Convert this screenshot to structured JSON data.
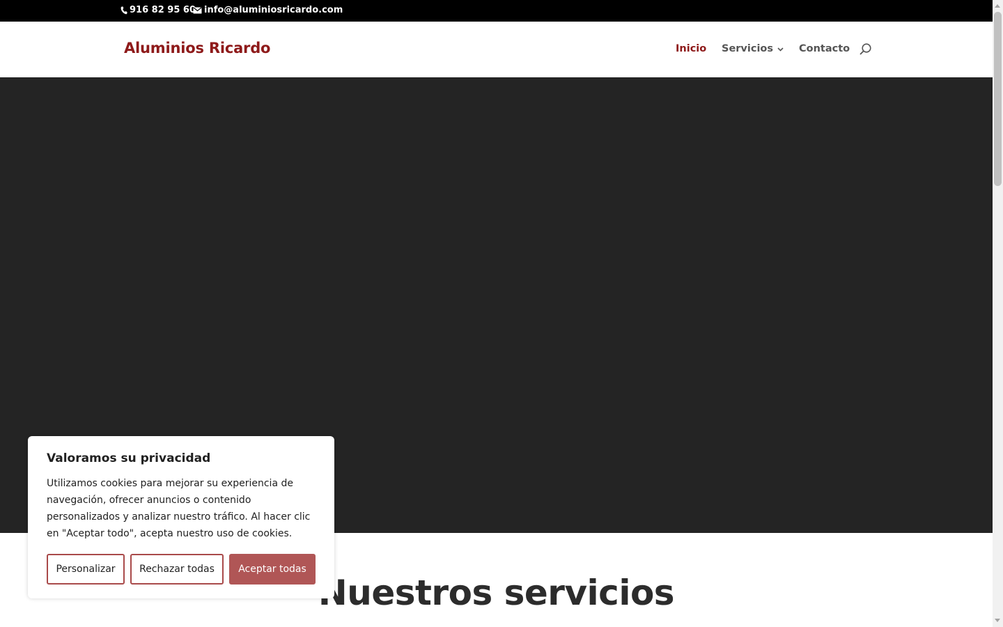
{
  "topbar": {
    "phone": "916 82 95 60",
    "email": "info@aluminiosricardo.com",
    "phone_icon": "phone-icon",
    "email_icon": "envelope-icon"
  },
  "header": {
    "logo": "Aluminios Ricardo",
    "nav": {
      "inicio": "Inicio",
      "servicios": "Servicios",
      "contacto": "Contacto"
    },
    "search_icon": "search-icon"
  },
  "main": {
    "section_title": "Nuestros servicios"
  },
  "cookie": {
    "title": "Valoramos su privacidad",
    "text": "Utilizamos cookies para mejorar su experiencia de navegación, ofrecer anuncios o contenido personalizados y analizar nuestro tráfico. Al hacer clic en \"Aceptar todo\", acepta nuestro uso de cookies.",
    "customize_label": "Personalizar",
    "reject_label": "Rechazar todas",
    "accept_label": "Aceptar todas"
  },
  "colors": {
    "brand": "#8e1a1a",
    "accept_button": "#b05656",
    "hero_bg": "#242424",
    "topbar_bg": "#000000"
  }
}
